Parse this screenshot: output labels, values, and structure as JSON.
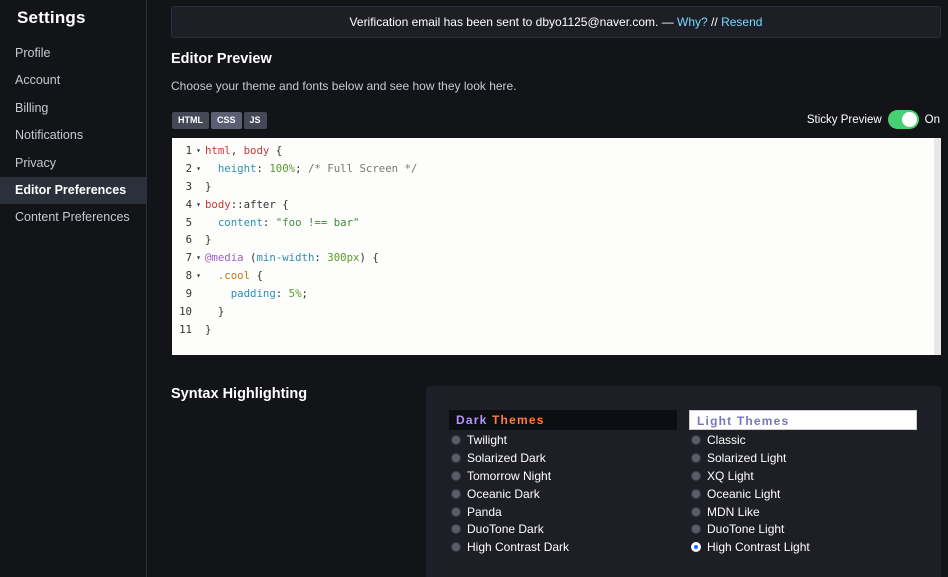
{
  "sidebar": {
    "title": "Settings",
    "items": [
      {
        "label": "Profile",
        "active": false
      },
      {
        "label": "Account",
        "active": false
      },
      {
        "label": "Billing",
        "active": false
      },
      {
        "label": "Notifications",
        "active": false
      },
      {
        "label": "Privacy",
        "active": false
      },
      {
        "label": "Editor Preferences",
        "active": true
      },
      {
        "label": "Content Preferences",
        "active": false
      }
    ]
  },
  "banner": {
    "text": "Verification email has been sent to dbyo1125@naver.com. — ",
    "why": "Why?",
    "sep": " // ",
    "resend": "Resend"
  },
  "preview": {
    "title": "Editor Preview",
    "desc": "Choose your theme and fonts below and see how they look here.",
    "tabs": [
      "HTML",
      "CSS",
      "JS"
    ],
    "active_tab": "CSS",
    "sticky_label": "Sticky Preview",
    "sticky_state": "On"
  },
  "code_lines": [
    {
      "n": "1",
      "fold": "▾",
      "html": "<span class='c-sel'>html</span>, <span class='c-sel'>body</span> {"
    },
    {
      "n": "2",
      "fold": "▾",
      "html": "  <span class='c-prop'>height</span>: <span class='c-num'>100%</span>; <span class='c-com'>/* Full Screen */</span>"
    },
    {
      "n": "3",
      "fold": "",
      "html": "}"
    },
    {
      "n": "4",
      "fold": "▾",
      "html": "<span class='c-sel'>body</span>::after {"
    },
    {
      "n": "5",
      "fold": "",
      "html": "  <span class='c-prop'>content</span>: <span class='c-str'>\"foo !== bar\"</span>"
    },
    {
      "n": "6",
      "fold": "",
      "html": "}"
    },
    {
      "n": "7",
      "fold": "▾",
      "html": "<span class='c-at'>@media</span> (<span class='c-prop'>min-width</span>: <span class='c-num'>300px</span>) {"
    },
    {
      "n": "8",
      "fold": "▾",
      "html": "  <span class='c-cls'>.cool</span> {"
    },
    {
      "n": "9",
      "fold": "",
      "html": "    <span class='c-prop'>padding</span>: <span class='c-num'>5%</span>;"
    },
    {
      "n": "10",
      "fold": "",
      "html": "  }"
    },
    {
      "n": "11",
      "fold": "",
      "html": "}"
    }
  ],
  "syntax": {
    "title": "Syntax Highlighting",
    "dark_head_1": "Dark",
    "dark_head_2": "Themes",
    "light_head": "Light Themes",
    "dark": [
      {
        "label": "Twilight",
        "checked": false
      },
      {
        "label": "Solarized Dark",
        "checked": false
      },
      {
        "label": "Tomorrow Night",
        "checked": false
      },
      {
        "label": "Oceanic Dark",
        "checked": false
      },
      {
        "label": "Panda",
        "checked": false
      },
      {
        "label": "DuoTone Dark",
        "checked": false
      },
      {
        "label": "High Contrast Dark",
        "checked": false
      }
    ],
    "light": [
      {
        "label": "Classic",
        "checked": false
      },
      {
        "label": "Solarized Light",
        "checked": false
      },
      {
        "label": "XQ Light",
        "checked": false
      },
      {
        "label": "Oceanic Light",
        "checked": false
      },
      {
        "label": "MDN Like",
        "checked": false
      },
      {
        "label": "DuoTone Light",
        "checked": false
      },
      {
        "label": "High Contrast Light",
        "checked": true
      }
    ]
  },
  "colors": {
    "toggle_on": "#47cf73",
    "accent_link": "#76daff"
  }
}
